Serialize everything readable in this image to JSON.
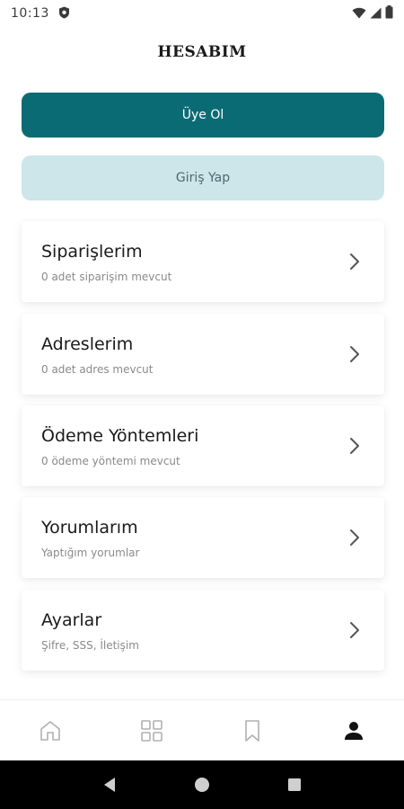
{
  "status_bar": {
    "time": "10:13"
  },
  "header": {
    "title": "HESABIM"
  },
  "auth": {
    "register_label": "Üye Ol",
    "login_label": "Giriş Yap"
  },
  "menu": {
    "items": [
      {
        "title": "Siparişlerim",
        "subtitle": "0 adet siparişim mevcut"
      },
      {
        "title": "Adreslerim",
        "subtitle": "0 adet adres mevcut"
      },
      {
        "title": "Ödeme Yöntemleri",
        "subtitle": "0 ödeme yöntemi mevcut"
      },
      {
        "title": "Yorumlarım",
        "subtitle": "Yaptığım yorumlar"
      },
      {
        "title": "Ayarlar",
        "subtitle": "Şifre, SSS, İletişim"
      }
    ]
  },
  "bottom_nav": {
    "items": [
      "home-icon",
      "grid-icon",
      "bookmark-icon",
      "person-icon"
    ],
    "active": "person-icon"
  },
  "colors": {
    "primary": "#0b6b75",
    "secondary_bg": "#cce6ea",
    "secondary_text": "#4d6a70"
  }
}
